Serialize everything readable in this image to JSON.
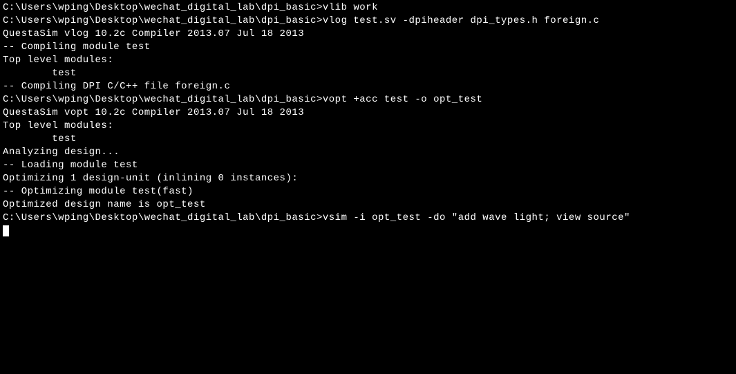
{
  "lines": [
    "C:\\Users\\wping\\Desktop\\wechat_digital_lab\\dpi_basic>vlib work",
    "",
    "C:\\Users\\wping\\Desktop\\wechat_digital_lab\\dpi_basic>vlog test.sv -dpiheader dpi_types.h foreign.c",
    "QuestaSim vlog 10.2c Compiler 2013.07 Jul 18 2013",
    "-- Compiling module test",
    "",
    "Top level modules:",
    "        test",
    "-- Compiling DPI C/C++ file foreign.c",
    "",
    "C:\\Users\\wping\\Desktop\\wechat_digital_lab\\dpi_basic>vopt +acc test -o opt_test",
    "QuestaSim vopt 10.2c Compiler 2013.07 Jul 18 2013",
    "",
    "Top level modules:",
    "        test",
    "",
    "Analyzing design...",
    "-- Loading module test",
    "Optimizing 1 design-unit (inlining 0 instances):",
    "-- Optimizing module test(fast)",
    "Optimized design name is opt_test",
    "",
    "C:\\Users\\wping\\Desktop\\wechat_digital_lab\\dpi_basic>vsim -i opt_test -do \"add wave light; view source\""
  ]
}
